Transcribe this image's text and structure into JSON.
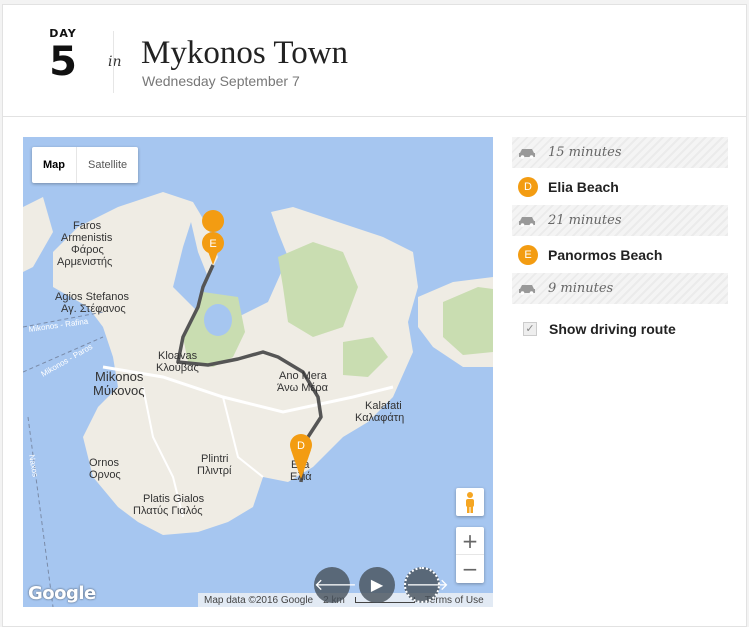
{
  "header": {
    "day_label": "DAY",
    "day_number": "5",
    "in_label": "in",
    "town": "Mykonos Town",
    "date": "Wednesday September 7"
  },
  "map": {
    "type_buttons": {
      "map": "Map",
      "satellite": "Satellite"
    },
    "labels": {
      "faros": "Faros",
      "armenistis": "Armenistis",
      "faros_gr": "Φάρος",
      "armenistis_gr": "Αρμενιστής",
      "agios_stefanos": "Agios Stefanos",
      "agios_stefanos_gr": "Αγ. Στέφανος",
      "rafina": "Mikonos - Rafina",
      "paros": "Mikonos - Paros",
      "klouvas": "Kloavas",
      "klouvas_gr": "Κλούβας",
      "mykonos": "Mikonos",
      "mykonos_gr": "Μύκονος",
      "ano_mera": "Ano Mera",
      "ano_mera_gr": "Άνω Μέρα",
      "kalafati": "Kalafati",
      "kalafati_gr": "Καλαφάτη",
      "plintri": "Plintri",
      "plintri_gr": "Πλιντρί",
      "ornos": "Ornos",
      "ornos_gr": "Ορνος",
      "platis_gialos": "Platis Gialos",
      "platis_gialos_gr": "Πλατύς Γιαλός",
      "elia": "Elia",
      "elia_gr": "Ελιά",
      "naxos": "Naxos"
    },
    "markers": {
      "start": "E",
      "end": "D"
    },
    "zoom_in": "+",
    "zoom_out": "−",
    "google": "Google",
    "attribution": "Map data ©2016 Google",
    "scale": "2 km",
    "terms": "Terms of Use",
    "controls": {
      "prev": "🡐",
      "play": "▶",
      "next": "🡒"
    }
  },
  "route": {
    "items": [
      {
        "kind": "drive",
        "text": "15 minutes"
      },
      {
        "kind": "stop",
        "badge": "D",
        "text": "Elia Beach"
      },
      {
        "kind": "drive",
        "text": "21 minutes"
      },
      {
        "kind": "stop",
        "badge": "E",
        "text": "Panormos Beach"
      },
      {
        "kind": "drive",
        "text": "9 minutes"
      }
    ],
    "show_driving_route_label": "Show driving route",
    "show_driving_route_checked": true
  },
  "colors": {
    "marker": "#f39c12",
    "water": "#a6c6f0",
    "land": "#efece4",
    "park": "#c9ddb1",
    "route": "#555555"
  }
}
